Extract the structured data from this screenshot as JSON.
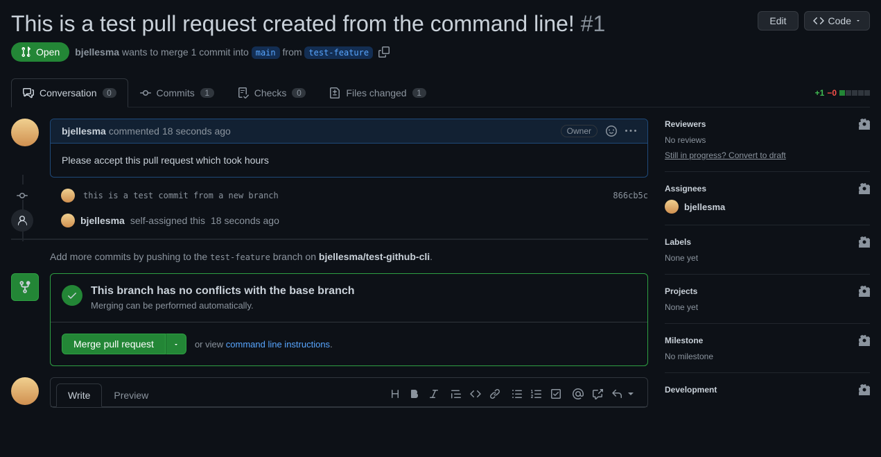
{
  "header": {
    "title": "This is a test pull request created from the command line!",
    "pr_number": "#1",
    "edit_label": "Edit",
    "code_label": "Code"
  },
  "meta": {
    "state": "Open",
    "author": "bjellesma",
    "merge_text_1": "wants to merge 1 commit into",
    "base_branch": "main",
    "merge_text_2": "from",
    "head_branch": "test-feature"
  },
  "tabs": {
    "conversation": {
      "label": "Conversation",
      "count": "0"
    },
    "commits": {
      "label": "Commits",
      "count": "1"
    },
    "checks": {
      "label": "Checks",
      "count": "0"
    },
    "files": {
      "label": "Files changed",
      "count": "1"
    }
  },
  "diffstat": {
    "add": "+1",
    "del": "−0"
  },
  "comment": {
    "author": "bjellesma",
    "action": "commented",
    "time": "18 seconds ago",
    "owner_badge": "Owner",
    "body": "Please accept this pull request which took hours"
  },
  "commit": {
    "message": "this is a test commit from a new branch",
    "sha": "866cb5c"
  },
  "event": {
    "author": "bjellesma",
    "text": "self-assigned this",
    "time": "18 seconds ago"
  },
  "push_hint": {
    "prefix": "Add more commits by pushing to the",
    "branch": "test-feature",
    "mid": "branch on",
    "repo": "bjellesma/test-github-cli",
    "suffix": "."
  },
  "merge": {
    "status_title": "This branch has no conflicts with the base branch",
    "status_sub": "Merging can be performed automatically.",
    "merge_btn": "Merge pull request",
    "alt_prefix": "or view",
    "alt_link": "command line instructions",
    "alt_suffix": "."
  },
  "compose": {
    "write": "Write",
    "preview": "Preview"
  },
  "sidebar": {
    "reviewers": {
      "title": "Reviewers",
      "line1": "No reviews",
      "line2": "Still in progress? Convert to draft"
    },
    "assignees": {
      "title": "Assignees",
      "user": "bjellesma"
    },
    "labels": {
      "title": "Labels",
      "body": "None yet"
    },
    "projects": {
      "title": "Projects",
      "body": "None yet"
    },
    "milestone": {
      "title": "Milestone",
      "body": "No milestone"
    },
    "development": {
      "title": "Development"
    }
  }
}
